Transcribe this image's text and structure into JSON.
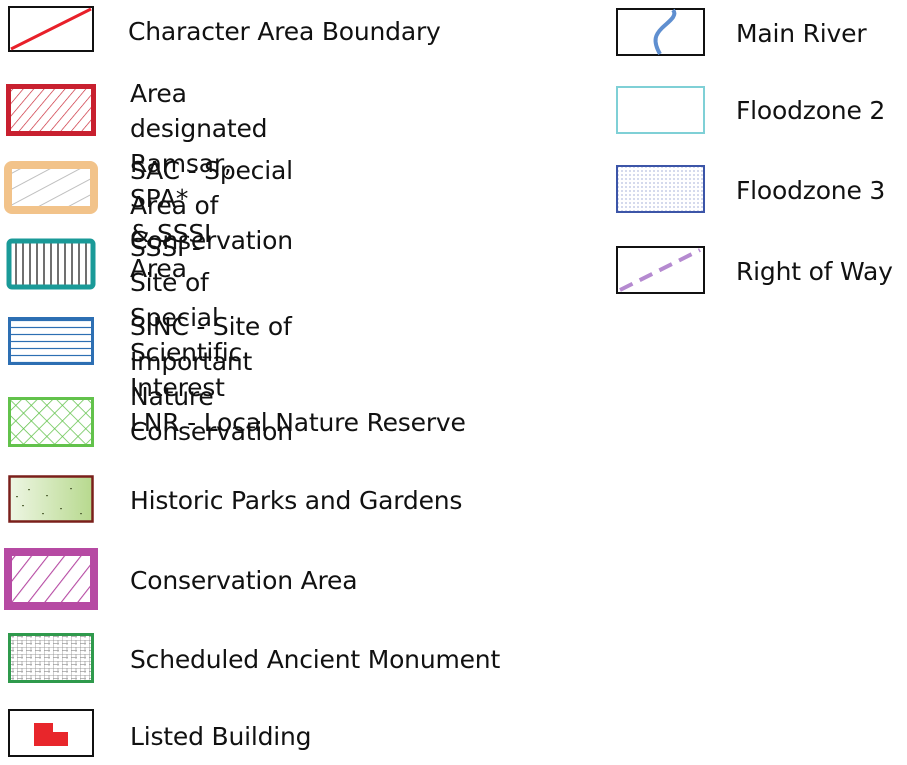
{
  "legend": {
    "left_column": [
      {
        "label": "Character Area Boundary",
        "symbol": "character-area-boundary-symbol"
      },
      {
        "label": "Area designated Ramsar, SPA*\n& SSSI Area",
        "symbol": "ramsar-spa-sssi-symbol"
      },
      {
        "label": "SAC - Special Area of\nConservation",
        "symbol": "sac-symbol"
      },
      {
        "label": "SSSI - Site of Special Scientific\nInterest",
        "symbol": "sssi-symbol"
      },
      {
        "label": "SINC - Site of Important Nature\nConservation",
        "symbol": "sinc-symbol"
      },
      {
        "label": "LNR - Local Nature Reserve",
        "symbol": "lnr-symbol"
      },
      {
        "label": "Historic Parks and Gardens",
        "symbol": "historic-parks-symbol"
      },
      {
        "label": "Conservation Area",
        "symbol": "conservation-area-symbol"
      },
      {
        "label": "Scheduled Ancient Monument",
        "symbol": "ancient-monument-symbol"
      },
      {
        "label": "Listed Building",
        "symbol": "listed-building-symbol"
      }
    ],
    "right_column": [
      {
        "label": "Main River",
        "symbol": "main-river-symbol"
      },
      {
        "label": "Floodzone 2",
        "symbol": "floodzone-2-symbol"
      },
      {
        "label": "Floodzone 3",
        "symbol": "floodzone-3-symbol"
      },
      {
        "label": "Right of Way",
        "symbol": "right-of-way-symbol"
      }
    ]
  },
  "colors": {
    "boundary_red": "#e8202a",
    "ramsar_red": "#c8202f",
    "sac_orange": "#f2c38a",
    "sssi_teal": "#1a9a98",
    "sinc_blue": "#2d6fb3",
    "lnr_green": "#62c24b",
    "historic_brown": "#7a1f1a",
    "historic_fill": "#c9e3a8",
    "conservation_magenta": "#b64aa3",
    "monument_green": "#2f9a4c",
    "listed_red": "#e8262b",
    "river_blue": "#5f8fd0",
    "floodzone2_cyan": "#7fd0d6",
    "floodzone3_blue": "#3c55a8",
    "right_of_way_purple": "#b58ad0"
  }
}
